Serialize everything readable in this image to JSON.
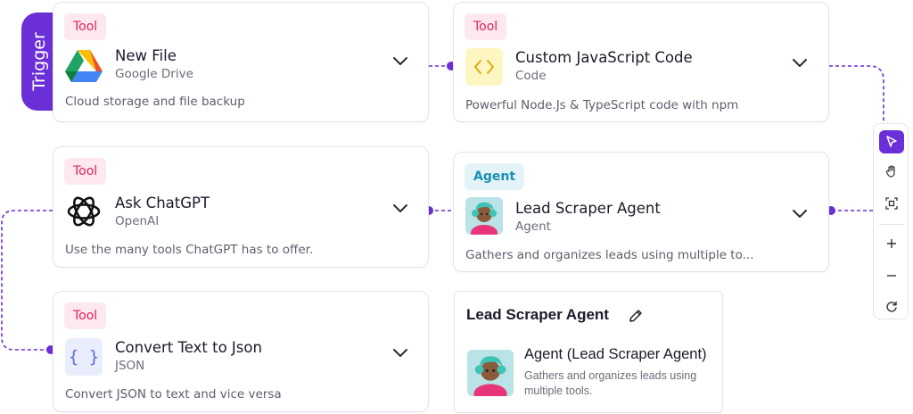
{
  "trigger_label": "Trigger",
  "nodes": {
    "new_file": {
      "badge": "Tool",
      "title": "New File",
      "subtitle": "Google Drive",
      "description": "Cloud storage and file backup",
      "icon": "google-drive-icon"
    },
    "custom_js": {
      "badge": "Tool",
      "title": "Custom JavaScript Code",
      "subtitle": "Code",
      "description": "Powerful Node.Js & TypeScript code with npm",
      "icon": "code-brackets-icon"
    },
    "ask_chatgpt": {
      "badge": "Tool",
      "title": "Ask ChatGPT",
      "subtitle": "OpenAI",
      "description": "Use the many tools ChatGPT has to offer.",
      "icon": "openai-icon"
    },
    "lead_scraper": {
      "badge": "Agent",
      "title": "Lead Scraper Agent",
      "subtitle": "Agent",
      "description": "Gathers and organizes leads using multiple to...",
      "icon": "agent-avatar-icon"
    },
    "convert_json": {
      "badge": "Tool",
      "title": "Convert Text to Json",
      "subtitle": "JSON",
      "description": "Convert JSON to text and vice versa",
      "icon": "json-braces-icon"
    }
  },
  "agent_panel": {
    "title": "Lead Scraper Agent",
    "agent_name": "Agent (Lead Scraper Agent)",
    "agent_description": "Gathers and organizes leads using multiple tools."
  },
  "toolbar": {
    "tools": [
      "cursor-icon",
      "hand-icon",
      "fit-view-icon",
      "zoom-in-icon",
      "zoom-out-icon",
      "reset-icon"
    ]
  },
  "colors": {
    "accent": "#6a2fd6",
    "tool_badge_bg": "#fde8ee",
    "tool_badge_text": "#e0245e",
    "agent_badge_bg": "#e3f3f8",
    "agent_badge_text": "#1b8eb3"
  }
}
